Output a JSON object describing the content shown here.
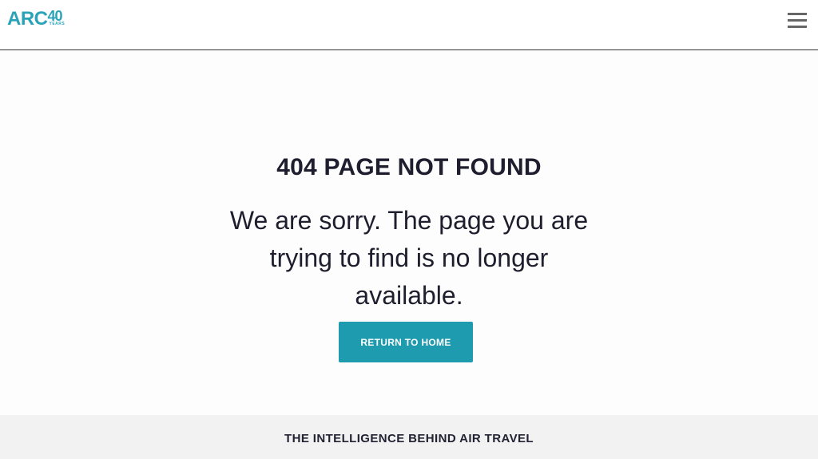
{
  "header": {
    "logo": {
      "brand": "ARC",
      "anniversary": "40",
      "years": "YEARS"
    },
    "menu_icon": "hamburger-menu-icon"
  },
  "main": {
    "title": "404 PAGE NOT FOUND",
    "message": "We are sorry. The page you are trying to find is no longer available.",
    "button_label": "RETURN TO HOME"
  },
  "footer": {
    "tagline": "THE INTELLIGENCE BEHIND AIR TRAVEL"
  },
  "colors": {
    "brand": "#2aa3b8",
    "button": "#1e9bae",
    "text": "#1e1e2f",
    "footer_bg": "#f2f2f2"
  }
}
